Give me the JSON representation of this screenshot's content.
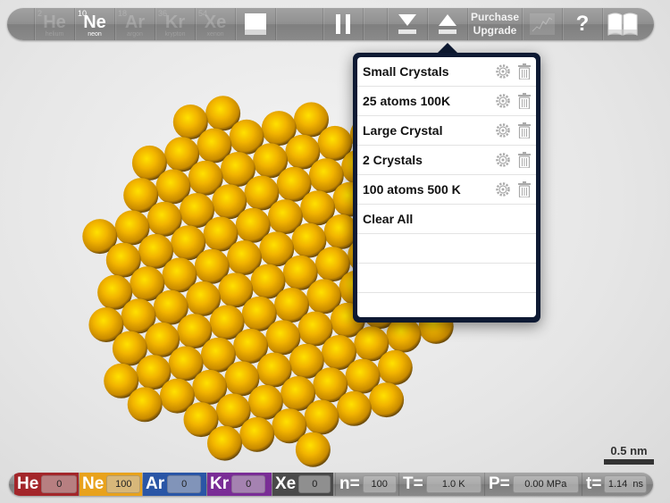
{
  "toolbar": {
    "elements": [
      {
        "number": "2",
        "symbol": "He",
        "name": "helium",
        "active": false
      },
      {
        "number": "10",
        "symbol": "Ne",
        "name": "neon",
        "active": true
      },
      {
        "number": "18",
        "symbol": "Ar",
        "name": "argon",
        "active": false
      },
      {
        "number": "36",
        "symbol": "Kr",
        "name": "krypton",
        "active": false
      },
      {
        "number": "54",
        "symbol": "Xe",
        "name": "xenon",
        "active": false
      }
    ],
    "purchase_line1": "Purchase",
    "purchase_line2": "Upgrade",
    "help_label": "?",
    "icons": [
      "stop-icon",
      "pause-icon",
      "save-icon",
      "load-icon",
      "graph-icon",
      "help-icon",
      "book-icon"
    ]
  },
  "popover": {
    "items": [
      {
        "label": "Small Crystals",
        "has_actions": true
      },
      {
        "label": "25 atoms 100K",
        "has_actions": true
      },
      {
        "label": "Large Crystal",
        "has_actions": true
      },
      {
        "label": "2 Crystals",
        "has_actions": true
      },
      {
        "label": "100 atoms 500 K",
        "has_actions": true
      },
      {
        "label": "Clear All",
        "has_actions": false
      },
      {
        "label": "",
        "has_actions": false
      },
      {
        "label": "",
        "has_actions": false
      },
      {
        "label": "",
        "has_actions": false
      }
    ]
  },
  "bottombar": {
    "elements": [
      {
        "symbol": "He",
        "count": "0",
        "color": "#a3262a"
      },
      {
        "symbol": "Ne",
        "count": "100",
        "color": "#e8a21c"
      },
      {
        "symbol": "Ar",
        "count": "0",
        "color": "#2a56a6"
      },
      {
        "symbol": "Kr",
        "count": "0",
        "color": "#7a2d96"
      },
      {
        "symbol": "Xe",
        "count": "0",
        "color": "#4a4a4a"
      }
    ],
    "stats": [
      {
        "label": "n=",
        "value": "100"
      },
      {
        "label": "T=",
        "value": "1.0 K"
      },
      {
        "label": "P=",
        "value": "0.00 MPa"
      },
      {
        "label": "t=",
        "value": "1.14  ns"
      }
    ]
  },
  "scale_bar": {
    "label": "0.5 nm"
  },
  "simulation": {
    "atom_element": "Ne",
    "atom_count": 100,
    "atom_color": "#f2b400"
  }
}
